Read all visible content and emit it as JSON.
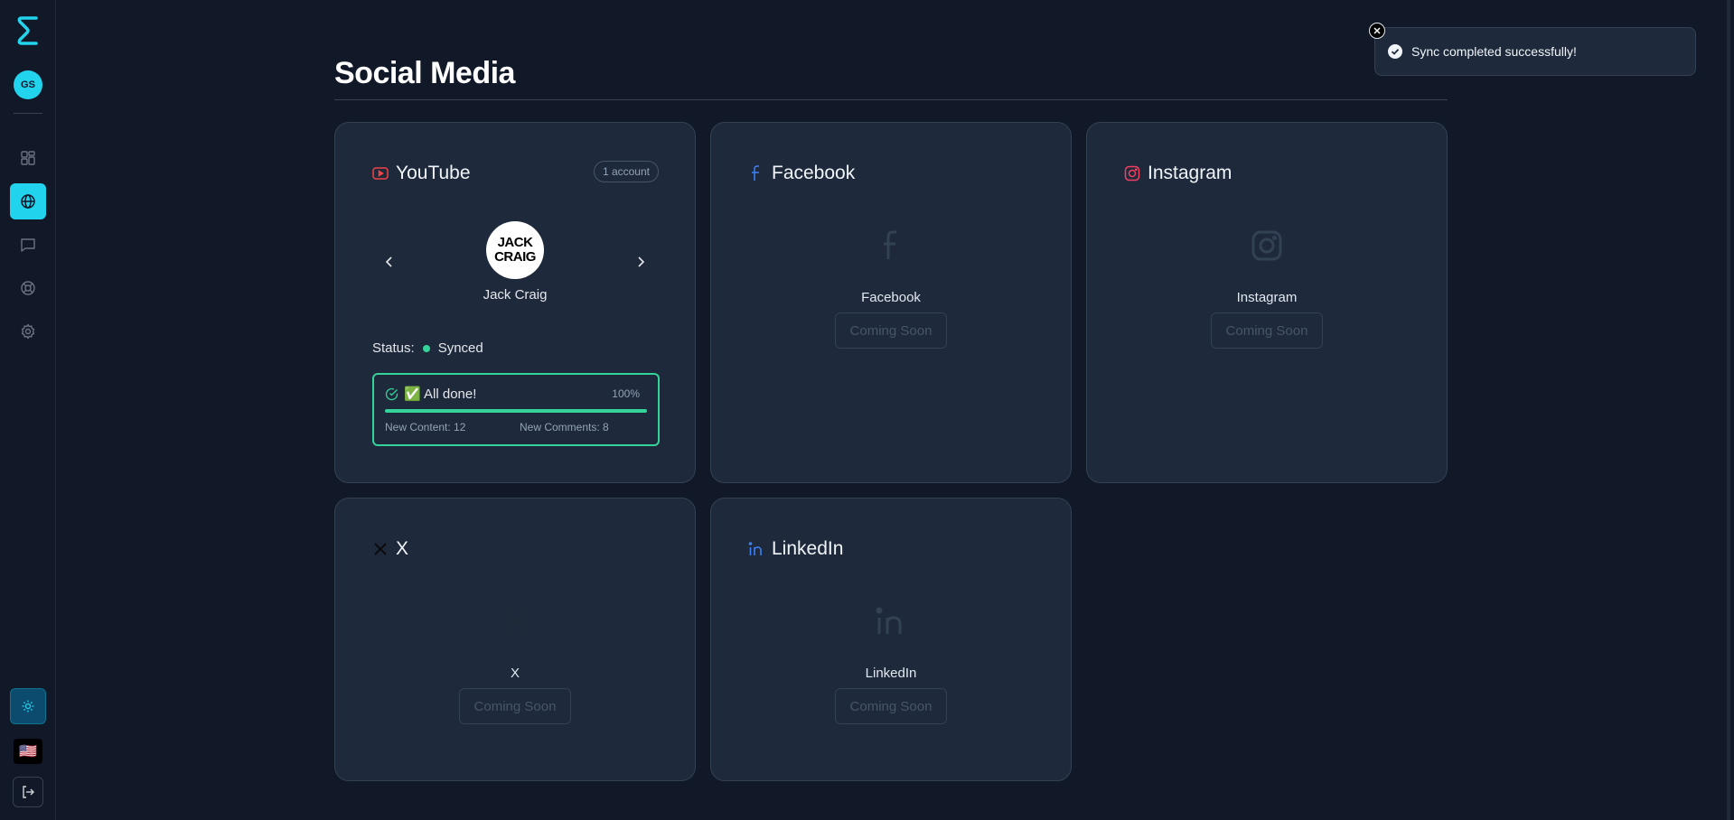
{
  "sidebar": {
    "user_initials": "GS",
    "nav": [
      {
        "name": "dashboard",
        "icon": "dashboard-icon",
        "active": false
      },
      {
        "name": "social-media",
        "icon": "globe-icon",
        "active": true
      },
      {
        "name": "messages",
        "icon": "chat-icon",
        "active": false
      },
      {
        "name": "support",
        "icon": "lifebuoy-icon",
        "active": false
      },
      {
        "name": "settings",
        "icon": "gear-icon",
        "active": false
      }
    ],
    "flag": "🇺🇸"
  },
  "page": {
    "title": "Social Media"
  },
  "cards": {
    "youtube": {
      "title": "YouTube",
      "badge": "1 account",
      "account": {
        "avatar_line1": "JACK",
        "avatar_line2": "CRAIG",
        "name": "Jack Craig"
      },
      "status_label": "Status:",
      "status_value": "Synced",
      "progress": {
        "title": "✅ All done!",
        "percent_text": "100%",
        "percent": 100,
        "new_content": "New Content: 12",
        "new_comments": "New Comments: 8"
      }
    },
    "facebook": {
      "title": "Facebook",
      "name": "Facebook",
      "cta": "Coming Soon"
    },
    "instagram": {
      "title": "Instagram",
      "name": "Instagram",
      "cta": "Coming Soon"
    },
    "x": {
      "title": "X",
      "name": "X",
      "cta": "Coming Soon"
    },
    "linkedin": {
      "title": "LinkedIn",
      "name": "LinkedIn",
      "cta": "Coming Soon"
    }
  },
  "toast": {
    "message": "Sync completed successfully!"
  },
  "colors": {
    "accent": "#22d3ee",
    "success": "#34d399",
    "youtube": "#ef4444",
    "facebook": "#3b82f6",
    "instagram": "#f43f5e",
    "linkedin": "#3b82f6"
  }
}
